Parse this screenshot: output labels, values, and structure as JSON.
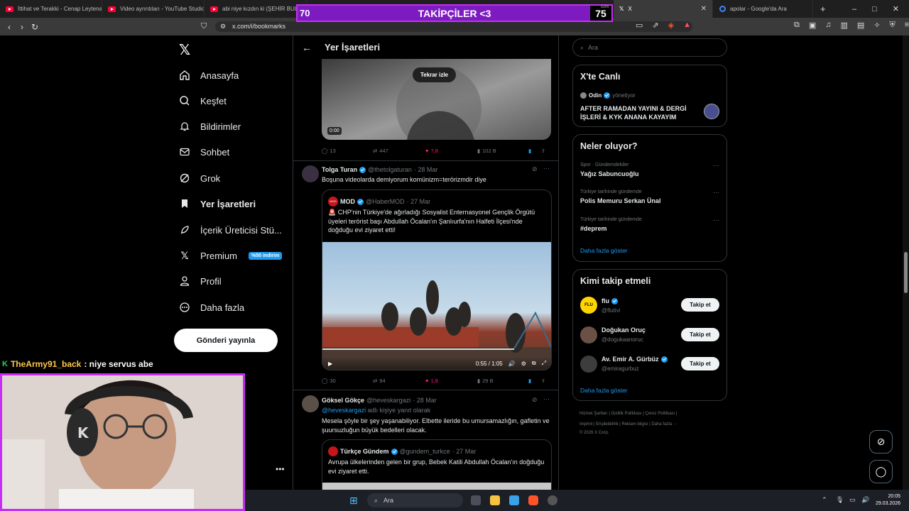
{
  "browser": {
    "tabs": [
      {
        "title": "İttihat ve Terakki - Cenap Leytenant"
      },
      {
        "title": "Video ayrıntıları - YouTube Studio"
      },
      {
        "title": "abi niye kızdın ki (ŞEHİR BULMA"
      },
      {
        "title": "X"
      },
      {
        "title": "apolar - Google'da Ara"
      }
    ],
    "url": "x.com/i/bookmarks",
    "new_tab": "+",
    "win_minimize": "–",
    "win_maximize": "□",
    "win_close": "✕"
  },
  "overlay": {
    "left_value": "70",
    "label": "TAKİPÇİLER <3",
    "right_value": "75",
    "corner_text": "GÜN"
  },
  "sidebar": {
    "logo": "𝕏",
    "items": [
      {
        "label": "Anasayfa"
      },
      {
        "label": "Keşfet"
      },
      {
        "label": "Bildirimler"
      },
      {
        "label": "Sohbet"
      },
      {
        "label": "Grok"
      },
      {
        "label": "Yer İşaretleri"
      },
      {
        "label": "İçerik Üreticisi Stü..."
      },
      {
        "label": "Premium",
        "badge": "%50 indirim"
      },
      {
        "label": "Profil"
      },
      {
        "label": "Daha fazla"
      }
    ],
    "post_button": "Gönderi yayınla",
    "more_dots": "•••"
  },
  "chat": {
    "user": "TheArmy91_back",
    "message": ": niye servus abe"
  },
  "main": {
    "back_arrow": "←",
    "title": "Yer İşaretleri",
    "tweet0": {
      "replay": "Tekrar izle",
      "video_time": "0:00",
      "replies": "13",
      "retweets": "447",
      "likes": "7,8",
      "views": "102 B"
    },
    "tweet1": {
      "name": "Tolga Turan",
      "handle": "@thetolgaturan",
      "date": "· 28 Mar",
      "text": "Boşuna videolarda demiyorum komünizm=terörizmdir diye",
      "quote": {
        "avatar_text": "MOD",
        "name": "MOD",
        "handle": "@HaberMOD",
        "date": "· 27 Mar",
        "text": "🚨 CHP'nin Türkiye'de ağırladığı Sosyalist Enternasyonel Gençlik Örgütü üyeleri terörist başı Abdullah Öcalan'ın Şanlıurfa'nın Halfeti İlçesi'nde doğduğu evi ziyaret etti!",
        "video_time": "0:55 / 1:05"
      },
      "replies": "30",
      "retweets": "94",
      "likes": "1,8",
      "views": "29 B"
    },
    "tweet2": {
      "name": "Göksel Gökçe",
      "handle": "@heveskargazi",
      "date": "· 28 Mar",
      "reply_to_handle": "@heveskargazi",
      "reply_to_suffix": " adlı kişiye yanıt olarak",
      "text": "Mesela şöyle bir şey yaşanabiliyor. Elbette ileride bu umursamazlığın, gafletin ve şuursuzluğun büyük bedelleri olacak.",
      "quote": {
        "name": "Türkçe Gündem",
        "handle": "@gundem_turkce",
        "date": "· 27 Mar",
        "text": "Avrupa ülkelerinden gelen bir grup, Bebek Katili Abdullah Öcalan'ın doğduğu evi ziyaret etti."
      }
    }
  },
  "right": {
    "search_placeholder": "Ara",
    "live": {
      "title": "X'te Canlı",
      "host": "Odin",
      "host_suffix": "yönetiyor",
      "stream_title": "AFTER RAMADAN YAYINI & DERGİ İŞLERİ & KYK ANANA KAYAYIM"
    },
    "trends": {
      "title": "Neler oluyor?",
      "items": [
        {
          "category": "Spor · Gündemdekiler",
          "name": "Yağız Sabuncuoğlu"
        },
        {
          "category": "Türkiye tarihinde gündemde",
          "name": "Polis Memuru Serkan Ünal"
        },
        {
          "category": "Türkiye tarihinde gündemde",
          "name": "#deprem"
        }
      ],
      "show_more": "Daha fazla göster"
    },
    "who_to_follow": {
      "title": "Kimi takip etmeli",
      "items": [
        {
          "name": "flu",
          "handle": "@flutivi",
          "button": "Takip et",
          "avatar_text": "FLU"
        },
        {
          "name": "Doğukan Oruç",
          "handle": "@dogukaanoruc",
          "button": "Takip et"
        },
        {
          "name": "Av. Emir A. Gürbüz",
          "handle": "@emiragurbuz",
          "button": "Takip et"
        }
      ],
      "show_more": "Daha fazla göster"
    },
    "footer": {
      "line1": [
        "Hizmet Şartları",
        "Gizlilik Politikası",
        "Çerez Politikası"
      ],
      "line2": [
        "Imprint",
        "Erişilebilirlik",
        "Reklam bilgisi",
        "Daha fazla ···"
      ],
      "copyright": "© 2026 X Corp."
    }
  },
  "taskbar": {
    "search": "Ara",
    "time": "20:05",
    "date": "29.03.2026"
  },
  "colors": {
    "accent": "#1d9bf0",
    "like": "#f91880",
    "overlay_border": "#c62ff3",
    "overlay_fill": "#7d1bc1"
  }
}
